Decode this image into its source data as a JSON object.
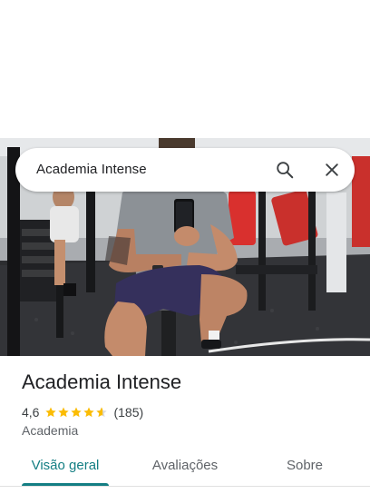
{
  "search": {
    "query": "Academia Intense",
    "search_icon": "search-icon",
    "close_icon": "close-icon"
  },
  "place": {
    "name": "Academia Intense",
    "rating": "4,6",
    "rating_value": 4.6,
    "stars_max": 5,
    "review_count": "(185)",
    "category": "Academia"
  },
  "tabs": [
    {
      "label": "Visão geral",
      "active": true
    },
    {
      "label": "Avaliações",
      "active": false
    },
    {
      "label": "Sobre",
      "active": false
    }
  ],
  "colors": {
    "accent": "#137e83",
    "star": "#fbbc04",
    "text_primary": "#202124",
    "text_secondary": "#5f6368"
  }
}
